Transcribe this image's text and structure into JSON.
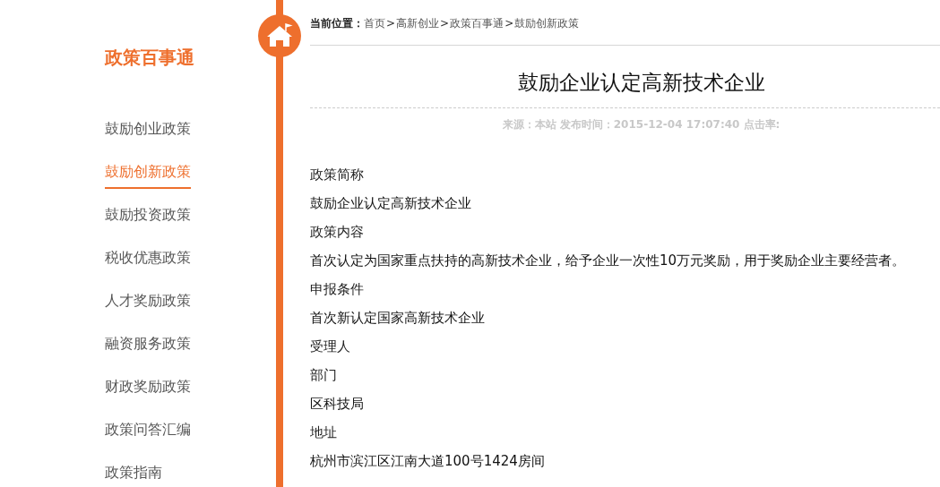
{
  "sidebar": {
    "title": "政策百事通",
    "items": [
      {
        "label": "鼓励创业政策",
        "selected": false
      },
      {
        "label": "鼓励创新政策",
        "selected": true
      },
      {
        "label": "鼓励投资政策",
        "selected": false
      },
      {
        "label": "税收优惠政策",
        "selected": false
      },
      {
        "label": "人才奖励政策",
        "selected": false
      },
      {
        "label": "融资服务政策",
        "selected": false
      },
      {
        "label": "财政奖励政策",
        "selected": false
      },
      {
        "label": "政策问答汇编",
        "selected": false
      },
      {
        "label": "政策指南",
        "selected": false
      }
    ]
  },
  "breadcrumb": {
    "label": "当前位置：",
    "parts": [
      {
        "kind": "link",
        "text": "首页"
      },
      {
        "kind": "sep",
        "text": ">"
      },
      {
        "kind": "link",
        "text": "高新创业"
      },
      {
        "kind": "sep",
        "text": ">"
      },
      {
        "kind": "link",
        "text": "政策百事通"
      },
      {
        "kind": "sep",
        "text": ">"
      },
      {
        "kind": "link",
        "text": "鼓励创新政策"
      }
    ]
  },
  "article": {
    "title": "鼓励企业认定高新技术企业",
    "meta": "来源：本站 发布时间：2015-12-04 17:07:40 点击率:",
    "lines": [
      {
        "kind": "heading",
        "text": "政策简称"
      },
      {
        "kind": "body",
        "text": "鼓励企业认定高新技术企业"
      },
      {
        "kind": "heading",
        "text": "政策内容"
      },
      {
        "kind": "body",
        "text": "首次认定为国家重点扶持的高新技术企业，给予企业一次性10万元奖励，用于奖励企业主要经营者。"
      },
      {
        "kind": "heading",
        "text": "申报条件"
      },
      {
        "kind": "body",
        "text": "首次新认定国家高新技术企业"
      },
      {
        "kind": "heading",
        "text": "受理人"
      },
      {
        "kind": "heading",
        "text": "部门"
      },
      {
        "kind": "body",
        "text": "区科技局"
      },
      {
        "kind": "heading",
        "text": "地址"
      },
      {
        "kind": "body",
        "text": "杭州市滨江区江南大道100号1424房间"
      }
    ]
  }
}
